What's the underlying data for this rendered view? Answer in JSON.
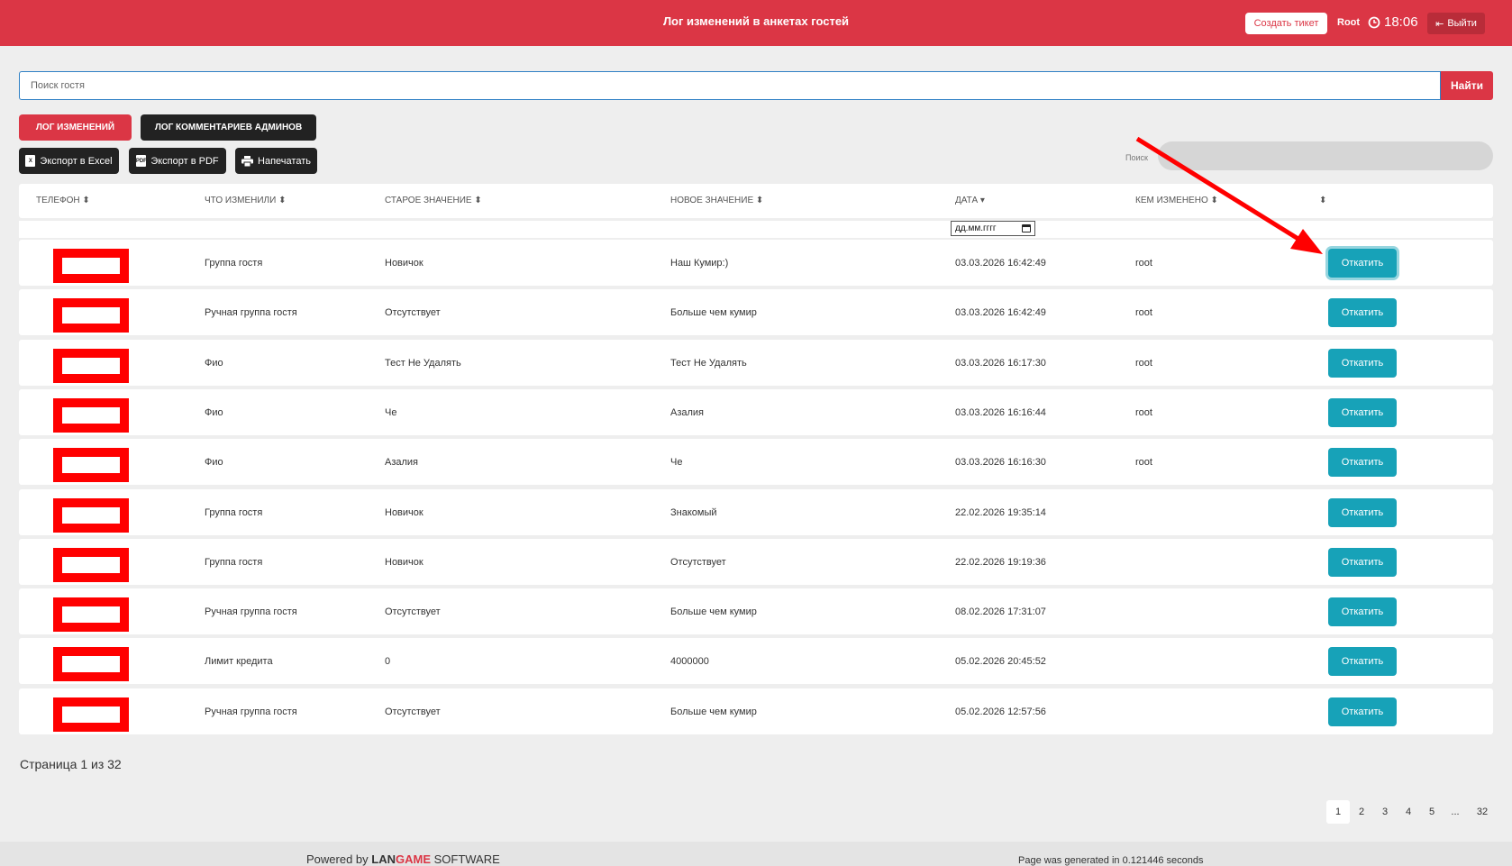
{
  "header": {
    "title": "Лог изменений в анкетах гостей",
    "create_ticket": "Создать тикет",
    "user": "Root",
    "time": "18:06",
    "logout": "Выйти"
  },
  "search": {
    "placeholder": "Поиск гостя",
    "button": "Найти"
  },
  "tabs": [
    {
      "label": "ЛОГ ИЗМЕНЕНИЙ",
      "active": true
    },
    {
      "label": "ЛОГ КОММЕНТАРИЕВ АДМИНОВ",
      "active": false
    }
  ],
  "export": [
    {
      "label": "Экспорт в Excel",
      "icon": "excel-icon",
      "icon_text": "X"
    },
    {
      "label": "Экспорт в PDF",
      "icon": "pdf-icon",
      "icon_text": "PDF"
    },
    {
      "label": "Напечатать",
      "icon": "printer-icon",
      "icon_text": ""
    }
  ],
  "filter": {
    "label": "Поиск"
  },
  "table": {
    "columns": [
      "ТЕЛЕФОН",
      "ЧТО ИЗМЕНИЛИ",
      "СТАРОЕ ЗНАЧЕНИЕ",
      "НОВОЕ ЗНАЧЕНИЕ",
      "ДАТА",
      "КЕМ ИЗМЕНЕНО",
      ""
    ],
    "date_placeholder": "дд.мм.гггг",
    "rollback_label": "Откатить",
    "rows": [
      {
        "field": "Группа гостя",
        "old": "Новичок",
        "new": "Наш Кумир:)",
        "date": "03.03.2026 16:42:49",
        "by": "root"
      },
      {
        "field": "Ручная группа гостя",
        "old": "Отсутствует",
        "new": "Больше чем кумир",
        "date": "03.03.2026 16:42:49",
        "by": "root"
      },
      {
        "field": "Фио",
        "old": "Тест Не Удалять",
        "new": "Тест Не Удалять",
        "date": "03.03.2026 16:17:30",
        "by": "root"
      },
      {
        "field": "Фио",
        "old": "Че",
        "new": "Азалия",
        "date": "03.03.2026 16:16:44",
        "by": "root"
      },
      {
        "field": "Фио",
        "old": "Азалия",
        "new": "Че",
        "date": "03.03.2026 16:16:30",
        "by": "root"
      },
      {
        "field": "Группа гостя",
        "old": "Новичок",
        "new": "Знакомый",
        "date": "22.02.2026 19:35:14",
        "by": ""
      },
      {
        "field": "Группа гостя",
        "old": "Новичок",
        "new": "Отсутствует",
        "date": "22.02.2026 19:19:36",
        "by": ""
      },
      {
        "field": "Ручная группа гостя",
        "old": "Отсутствует",
        "new": "Больше чем кумир",
        "date": "08.02.2026 17:31:07",
        "by": ""
      },
      {
        "field": "Лимит кредита",
        "old": "0",
        "new": "4000000",
        "date": "05.02.2026 20:45:52",
        "by": ""
      },
      {
        "field": "Ручная группа гостя",
        "old": "Отсутствует",
        "new": "Больше чем кумир",
        "date": "05.02.2026 12:57:56",
        "by": ""
      }
    ]
  },
  "pagination": {
    "info": "Страница 1 из 32",
    "pages": [
      "1",
      "2",
      "3",
      "4",
      "5",
      "...",
      "32"
    ],
    "current": "1"
  },
  "footer": {
    "powered_prefix": "Powered by ",
    "brand_a": "LAN",
    "brand_b": "GAME",
    "brand_c": " SOFTWARE",
    "generated": "Page was generated in 0.121446 seconds"
  },
  "colors": {
    "brand_red": "#db3645",
    "teal": "#17a2b8",
    "dark": "#222222",
    "annotation_red": "#ff0000"
  }
}
